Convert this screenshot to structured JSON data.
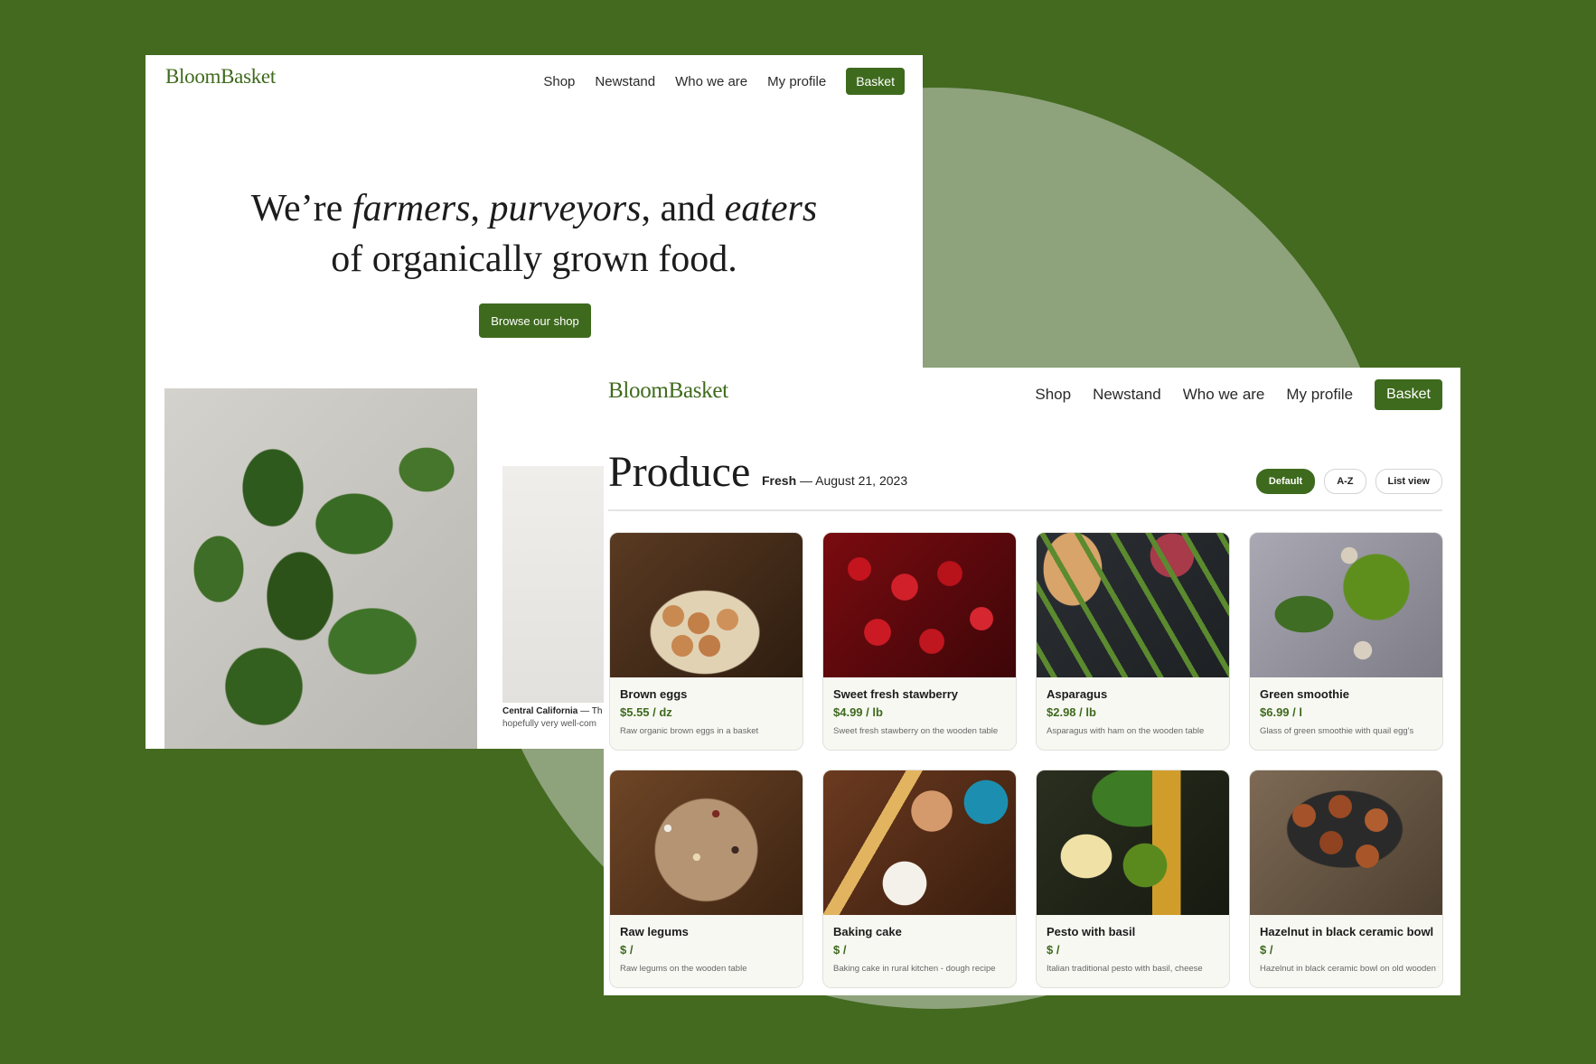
{
  "colors": {
    "background": "#436a1f",
    "accent": "#3e6a1d",
    "circle": "#8ea27c"
  },
  "brand": {
    "name": "BloomBasket"
  },
  "nav": {
    "items": [
      "Shop",
      "Newstand",
      "Who we are",
      "My profile"
    ],
    "basket_label": "Basket"
  },
  "home": {
    "hero": {
      "p1": "We’re ",
      "e1": "farmers",
      "p2": ", ",
      "e2": "purveyors",
      "p3": ", and ",
      "e3": "eaters",
      "line2": "of organically grown food."
    },
    "browse_button": "Browse our shop",
    "caption": {
      "title": "Central California",
      "rest": " — Th",
      "sub": "hopefully very well-com"
    }
  },
  "shop": {
    "title": "Produce",
    "subtitle_bold": "Fresh",
    "subtitle_rest": " — August 21, 2023",
    "sort_options": [
      "Default",
      "A-Z",
      "List view"
    ],
    "selected_sort": "Default",
    "products": [
      {
        "name": "Brown eggs",
        "price": "$5.55 / dz",
        "description": "Raw organic brown eggs in a basket",
        "image_icon": "eggs-photo"
      },
      {
        "name": "Sweet fresh stawberry",
        "price": "$4.99 / lb",
        "description": "Sweet fresh stawberry on the wooden table",
        "image_icon": "strawberry-photo"
      },
      {
        "name": "Asparagus",
        "price": "$2.98 / lb",
        "description": "Asparagus with ham on the wooden table",
        "image_icon": "asparagus-photo"
      },
      {
        "name": "Green smoothie",
        "price": "$6.99 / l",
        "description": "Glass of green smoothie with quail egg's",
        "image_icon": "smoothie-photo"
      },
      {
        "name": "Raw legums",
        "price": "$ /",
        "description": "Raw legums on the wooden table",
        "image_icon": "legumes-photo"
      },
      {
        "name": "Baking cake",
        "price": "$ /",
        "description": "Baking cake in rural kitchen - dough recipe",
        "image_icon": "baking-photo"
      },
      {
        "name": "Pesto with basil",
        "price": "$ /",
        "description": "Italian traditional pesto with basil, cheese",
        "image_icon": "pesto-photo"
      },
      {
        "name": "Hazelnut in black ceramic bowl",
        "price": "$ /",
        "description": "Hazelnut in black ceramic bowl on old wooden table",
        "image_icon": "hazelnut-photo"
      }
    ]
  }
}
